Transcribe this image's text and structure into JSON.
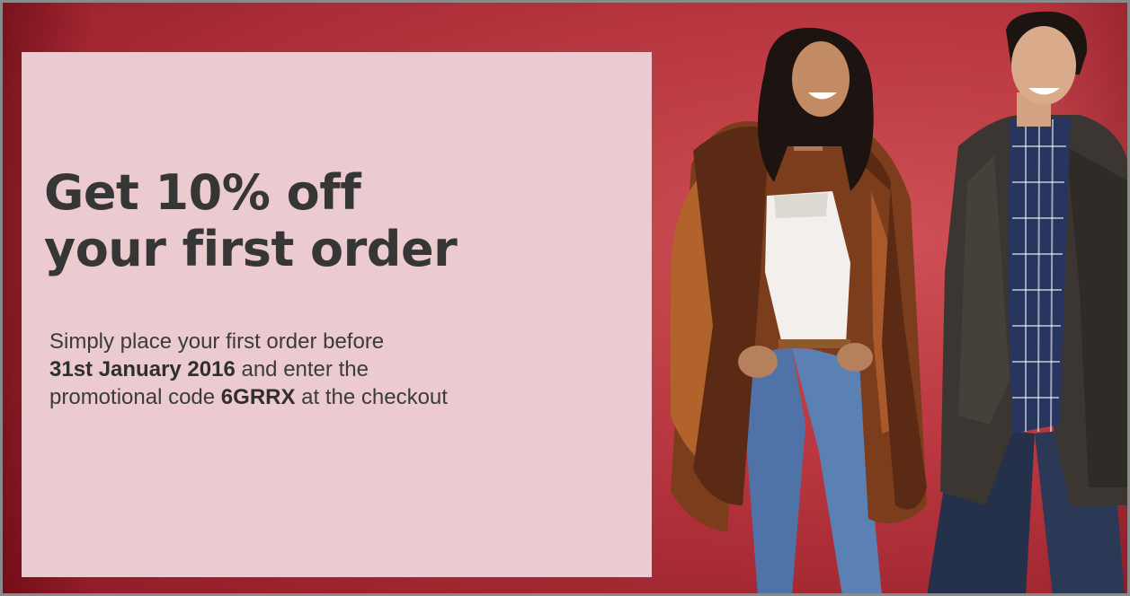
{
  "banner": {
    "headline_line1": "Get 10% off",
    "headline_line2": "your first order",
    "body_part1": "Simply place your first order before",
    "deadline": "31st January 2016",
    "body_part2": "and enter the",
    "body_part3": "promotional code",
    "promo_code": "6GRRX",
    "body_part4": "at the checkout"
  },
  "colors": {
    "background": "#b8363f",
    "panel": "#ebcbd0",
    "text": "#363636"
  },
  "images": [
    {
      "name": "woman-model-image",
      "depicts": "smiling woman in brown shearling coat, white top and blue jeans"
    },
    {
      "name": "man-model-image",
      "depicts": "smiling man in dark parka and blue check shirt"
    }
  ]
}
